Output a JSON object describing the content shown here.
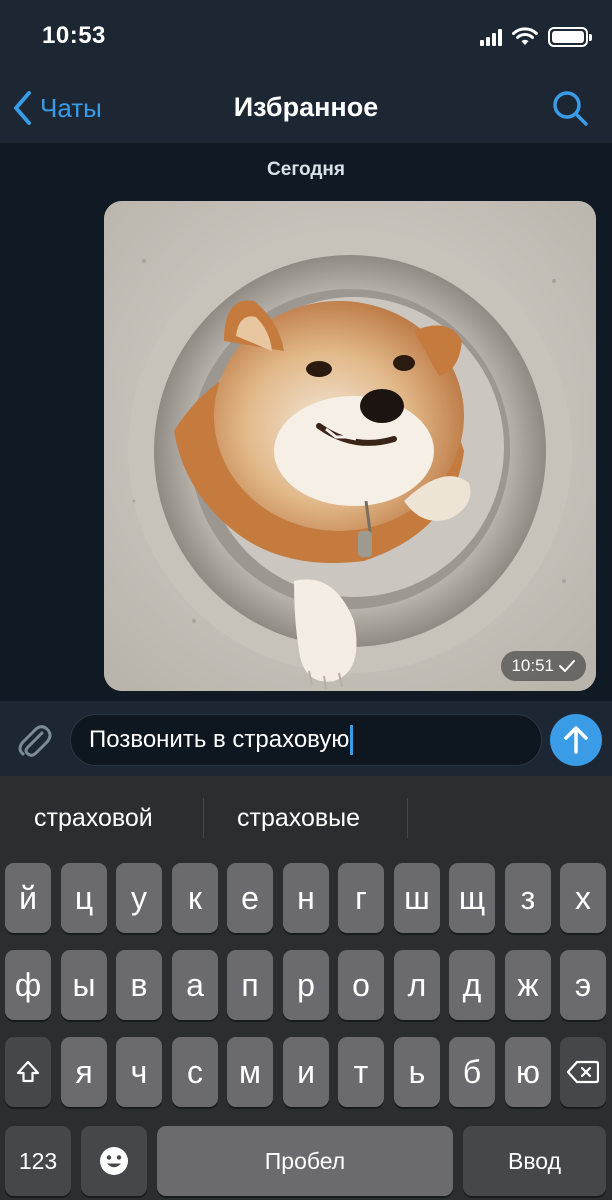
{
  "status_bar": {
    "time": "10:53"
  },
  "nav": {
    "back_label": "Чаты",
    "title": "Избранное"
  },
  "chat": {
    "date_label": "Сегодня",
    "message": {
      "time": "10:51"
    }
  },
  "composer": {
    "text": "Позвонить в страховую"
  },
  "suggestions": [
    "страховой",
    "страховые"
  ],
  "keyboard": {
    "row1": [
      "й",
      "ц",
      "у",
      "к",
      "е",
      "н",
      "г",
      "ш",
      "щ",
      "з",
      "х"
    ],
    "row2": [
      "ф",
      "ы",
      "в",
      "а",
      "п",
      "р",
      "о",
      "л",
      "д",
      "ж",
      "э"
    ],
    "row3": [
      "я",
      "ч",
      "с",
      "м",
      "и",
      "т",
      "ь",
      "б",
      "ю"
    ],
    "numbers_label": "123",
    "space_label": "Пробел",
    "return_label": "Ввод"
  },
  "colors": {
    "accent": "#3a9be6",
    "bar_bg": "#1c2733",
    "chat_bg": "#0f1a24",
    "key_bg": "#6b6b6f",
    "keyboard_bg": "#2b2d31"
  },
  "icons": {
    "back": "chevron-left-icon",
    "search": "search-icon",
    "attach": "paperclip-icon",
    "send": "arrow-up-icon",
    "shift": "shift-icon",
    "delete": "backspace-icon",
    "emoji": "emoji-icon",
    "read": "checkmark-icon"
  }
}
